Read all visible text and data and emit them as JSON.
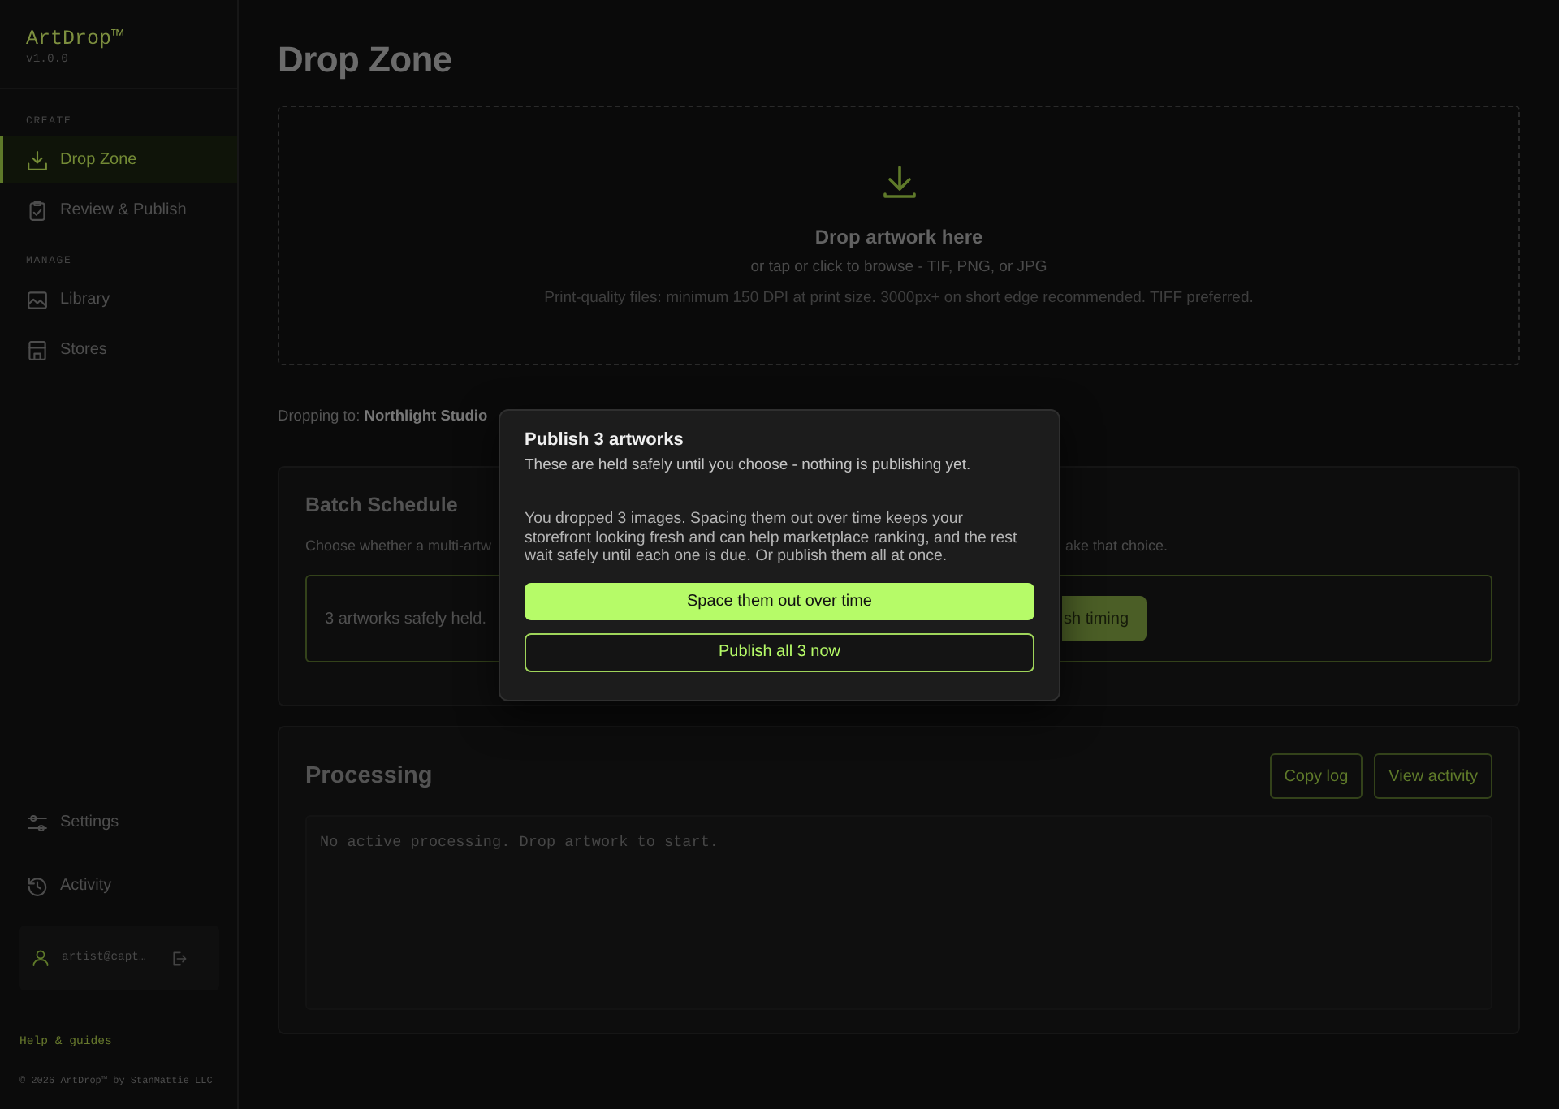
{
  "sidebar": {
    "brand": "ArtDrop™",
    "version": "v1.0.0",
    "sections": [
      {
        "heading": "CREATE",
        "items": [
          {
            "label": "Drop Zone",
            "selected": true
          },
          {
            "label": "Review & Publish",
            "selected": false
          }
        ]
      },
      {
        "heading": "MANAGE",
        "items": [
          {
            "label": "Library",
            "selected": false
          },
          {
            "label": "Stores",
            "selected": false
          }
        ]
      }
    ],
    "bottom_items": [
      {
        "label": "Settings",
        "selected": false
      },
      {
        "label": "Activity",
        "selected": false
      }
    ],
    "account": {
      "email": "artist@capt…"
    },
    "help_link": "Help & guides",
    "copyright": "© 2026 ArtDrop™ by StanMattie LLC"
  },
  "page": {
    "title": "Drop Zone"
  },
  "drop_area": {
    "title": "Drop artwork here",
    "hint": "or tap or click to browse - TIF, PNG, or JPG",
    "requirements": "Print-quality files: minimum 150 DPI at print size. 3000px+ on short edge recommended. TIFF preferred."
  },
  "target": {
    "text": "Dropping to: **Northlight Studio**"
  },
  "batch_schedule": {
    "title": "Batch Schedule",
    "description_visible_parts": [
      "Choose whether a multi-artw",
      "ake that choice."
    ],
    "status": "3 artworks safely held.",
    "action_button": "sh timing"
  },
  "processing": {
    "title": "Processing",
    "actions": [
      "Copy log",
      "View activity"
    ],
    "log": "No active processing. Drop artwork to start."
  },
  "dialog": {
    "title": "Publish 3 artworks",
    "subtitle": "These are held safely until you choose - nothing is publishing yet.",
    "message": "You dropped 3 images. Spacing them out over time keeps your storefront looking fresh and can help marketplace ranking, and the rest wait safely until each one is due. Or publish them all at once.",
    "buttons": [
      {
        "label": "Space them out over time",
        "kind": "primary"
      },
      {
        "label": "Publish all 3 now",
        "kind": "secondary"
      }
    ]
  }
}
